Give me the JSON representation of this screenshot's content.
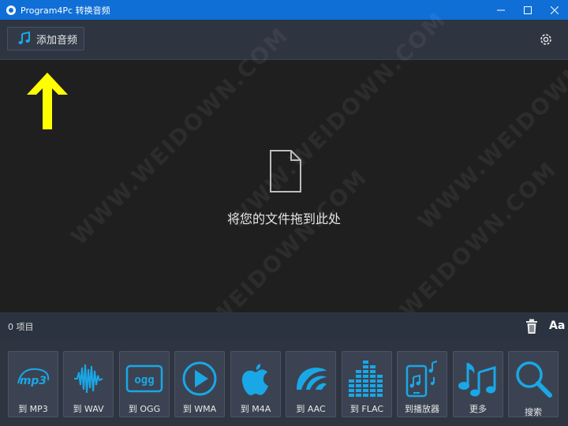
{
  "window": {
    "title": "Program4Pc 转换音频"
  },
  "toolbar": {
    "add_label": "添加音频"
  },
  "dropzone": {
    "text": "将您的文件拖到此处"
  },
  "status": {
    "count": "0 项目",
    "font_label": "Aa"
  },
  "formats": [
    {
      "id": "mp3",
      "label": "到 MP3",
      "icon": "mp3-icon"
    },
    {
      "id": "wav",
      "label": "到 WAV",
      "icon": "waveform-icon"
    },
    {
      "id": "ogg",
      "label": "到 OGG",
      "icon": "ogg-icon"
    },
    {
      "id": "wma",
      "label": "到 WMA",
      "icon": "play-icon"
    },
    {
      "id": "m4a",
      "label": "到 M4A",
      "icon": "apple-icon"
    },
    {
      "id": "aac",
      "label": "到 AAC",
      "icon": "aac-icon"
    },
    {
      "id": "flac",
      "label": "到 FLAC",
      "icon": "equalizer-icon"
    },
    {
      "id": "player",
      "label": "到播放器",
      "icon": "phone-music-icon"
    },
    {
      "id": "more",
      "label": "更多",
      "icon": "music-notes-icon"
    },
    {
      "id": "search",
      "label": "搜索",
      "icon": "search-icon"
    }
  ],
  "watermark": "WWW.WEIDOWN.COM",
  "colors": {
    "accent": "#0f6fd6",
    "icon_blue": "#1aa7e6",
    "arrow": "#ffff00"
  }
}
